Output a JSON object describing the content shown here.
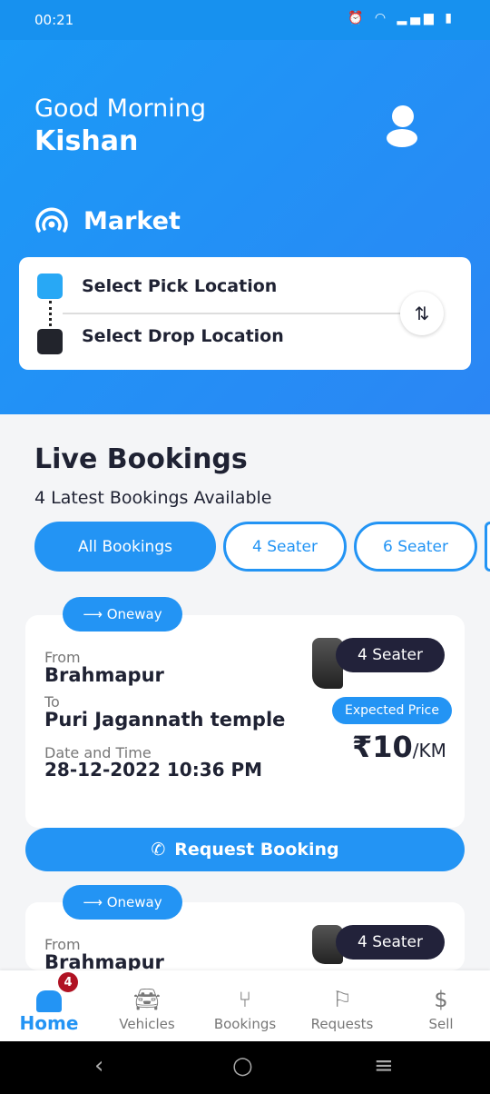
{
  "status_bar": {
    "time": "00:21",
    "icons": [
      "alarm-icon",
      "volte-icon",
      "wifi-icon",
      "signal-icon",
      "battery-icon"
    ]
  },
  "header": {
    "greeting": "Good Morning",
    "user_name": "Kishan",
    "market_label": "Market"
  },
  "location": {
    "pick": "Select Pick Location",
    "drop": "Select Drop Location"
  },
  "live": {
    "title": "Live Bookings",
    "subtitle": "4 Latest Bookings Available"
  },
  "filters": [
    {
      "label": "All Bookings",
      "active": true
    },
    {
      "label": "4 Seater"
    },
    {
      "label": "6 Seater"
    }
  ],
  "bookings": [
    {
      "type": "Oneway",
      "from_label": "From",
      "from": "Brahmapur",
      "to_label": "To",
      "to": "Puri Jagannath temple",
      "dt_label": "Date and Time",
      "datetime": "28-12-2022 10:36 PM",
      "seater": "4 Seater",
      "expected_label": "Expected Price",
      "price": "₹10",
      "unit": "/KM",
      "action": "Request Booking"
    },
    {
      "type": "Oneway",
      "from_label": "From",
      "from": "Brahmapur",
      "seater": "4 Seater"
    }
  ],
  "nav": [
    {
      "label": "Home",
      "badge": "4",
      "active": true
    },
    {
      "label": "Vehicles"
    },
    {
      "label": "Bookings"
    },
    {
      "label": "Requests"
    },
    {
      "label": "Sell"
    }
  ],
  "colors": {
    "primary": "#2394f4",
    "dark": "#22223a",
    "badge": "#b01223"
  }
}
